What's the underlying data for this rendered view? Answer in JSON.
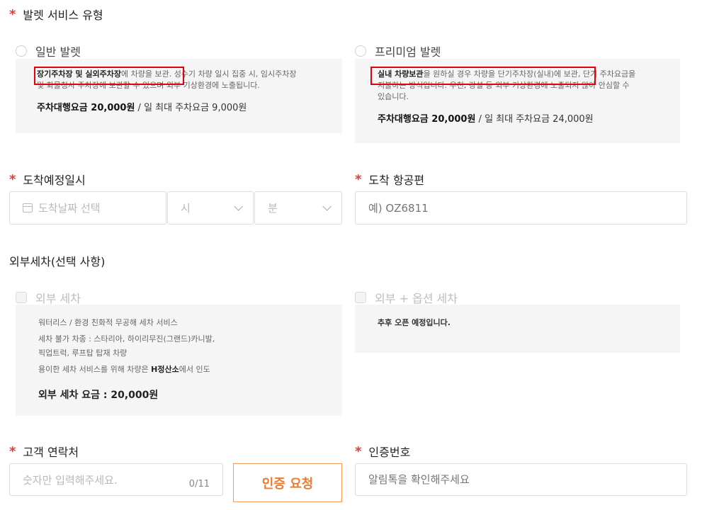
{
  "service": {
    "required_mark": "*",
    "title": "발렛 서비스 유형",
    "options": [
      {
        "label": "일반 발렛",
        "desc_bold": "장기주차장 및 실외주차장",
        "desc_rest": "에 차량을 보관. 성수기 차량 일시 집중 시, 임시주차장",
        "desc_line2": "및 화물청사 주차장에 보관할 수 있으며 외부 기상환경에 노출됩니다.",
        "price_bold": "주차대행요금 20,000원",
        "price_rest": " / 일 최대 주차요금 9,000원"
      },
      {
        "label": "프리미엄 발렛",
        "desc_bold": "실내 차량보관",
        "desc_rest": "을 원하실 경우 차량을 단기주차장(실내)에 보관, 단기 주차요금을",
        "desc_line2": "지불하는 방식입니다. 우천, 강설 등 외부 기상환경에 노출되지 않아 안심할 수",
        "desc_line3": "있습니다.",
        "price_bold": "주차대행요금 20,000원",
        "price_rest": " / 일 최대 주차요금 24,000원"
      }
    ]
  },
  "arrival": {
    "required_mark": "*",
    "title": "도착예정일시",
    "date_placeholder": "도착날짜 선택",
    "hour_placeholder": "시",
    "minute_placeholder": "분"
  },
  "flight": {
    "required_mark": "*",
    "title": "도착 항공편",
    "placeholder": "예) OZ6811"
  },
  "wash": {
    "title": "외부세차(선택 사항)",
    "options": [
      {
        "label": "외부 세차",
        "line1": "워터리스 / 환경 친화적 무공해 세차 서비스",
        "line2": "세차 불가 차종 : 스타리아, 하이리무진(그랜드)카니발,",
        "line3": "픽업트럭, 루프탑 탑재 차량",
        "line4_pre": "용이한 세차 서비스를 위해 차량은 ",
        "line4_bold": "H정산소",
        "line4_post": "에서 인도",
        "price": "외부 세차 요금 : 20,000원"
      },
      {
        "label": "외부 + 옵션 세차",
        "notice": "추후 오픈 예정입니다."
      }
    ]
  },
  "contact": {
    "required_mark": "*",
    "title": "고객 연락처",
    "placeholder": "숫자만 입력해주세요.",
    "counter": "0/11",
    "button": "인증 요청"
  },
  "auth_code": {
    "required_mark": "*",
    "title": "인증번호",
    "placeholder": "알림톡을 확인해주세요"
  },
  "colors": {
    "required": "#e8382f",
    "highlight": "#e1000f",
    "accent": "#f07a2b"
  }
}
